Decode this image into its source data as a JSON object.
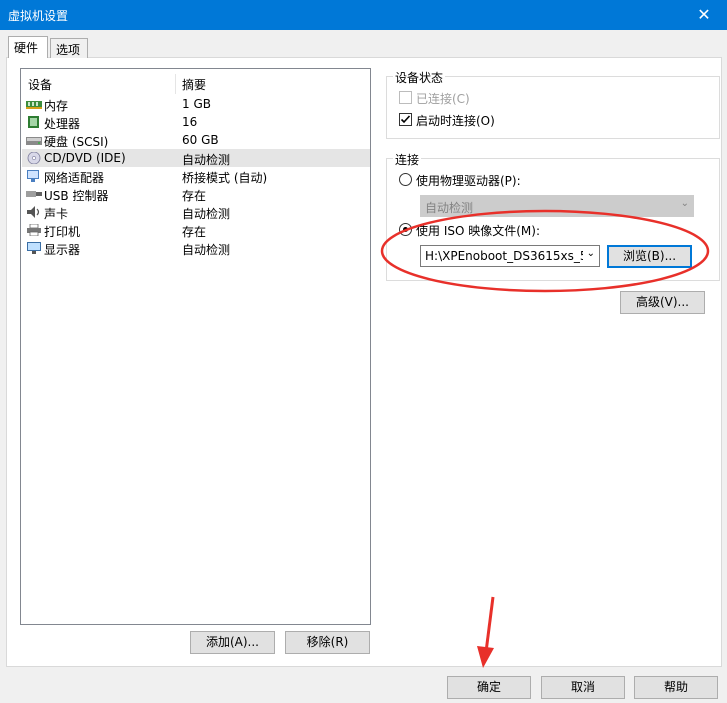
{
  "window": {
    "title": "虚拟机设置",
    "close_glyph": "✕"
  },
  "tabs": [
    {
      "label": "硬件",
      "active": true
    },
    {
      "label": "选项",
      "active": false
    }
  ],
  "device_list": {
    "headers": {
      "device": "设备",
      "summary": "摘要"
    },
    "rows": [
      {
        "name": "内存",
        "summary": "1 GB",
        "icon": "memory-icon"
      },
      {
        "name": "处理器",
        "summary": "16",
        "icon": "cpu-icon"
      },
      {
        "name": "硬盘 (SCSI)",
        "summary": "60 GB",
        "icon": "harddisk-icon"
      },
      {
        "name": "CD/DVD (IDE)",
        "summary": "自动检测",
        "icon": "cd-dvd-icon",
        "selected": true
      },
      {
        "name": "网络适配器",
        "summary": "桥接模式 (自动)",
        "icon": "network-adapter-icon"
      },
      {
        "name": "USB 控制器",
        "summary": "存在",
        "icon": "usb-icon"
      },
      {
        "name": "声卡",
        "summary": "自动检测",
        "icon": "speaker-icon"
      },
      {
        "name": "打印机",
        "summary": "存在",
        "icon": "printer-icon"
      },
      {
        "name": "显示器",
        "summary": "自动检测",
        "icon": "monitor-icon"
      }
    ],
    "add_label": "添加(A)...",
    "remove_label": "移除(R)"
  },
  "device_status": {
    "title": "设备状态",
    "connected_label": "已连接(C)",
    "connected_checked": false,
    "connect_on_start_label": "启动时连接(O)",
    "connect_on_start_checked": true
  },
  "connection": {
    "title": "连接",
    "physical_label": "使用物理驱动器(P):",
    "physical_selected": false,
    "physical_value": "自动检测",
    "iso_label": "使用 ISO 映像文件(M):",
    "iso_selected": true,
    "iso_value": "H:\\XPEnoboot_DS3615xs_5",
    "browse_label": "浏览(B)..."
  },
  "advanced_label": "高级(V)...",
  "footer": {
    "ok_label": "确定",
    "cancel_label": "取消",
    "help_label": "帮助"
  },
  "colors": {
    "titlebar": "#0078d7",
    "annotation": "#e8302a",
    "selection": "#e5e5e5"
  }
}
